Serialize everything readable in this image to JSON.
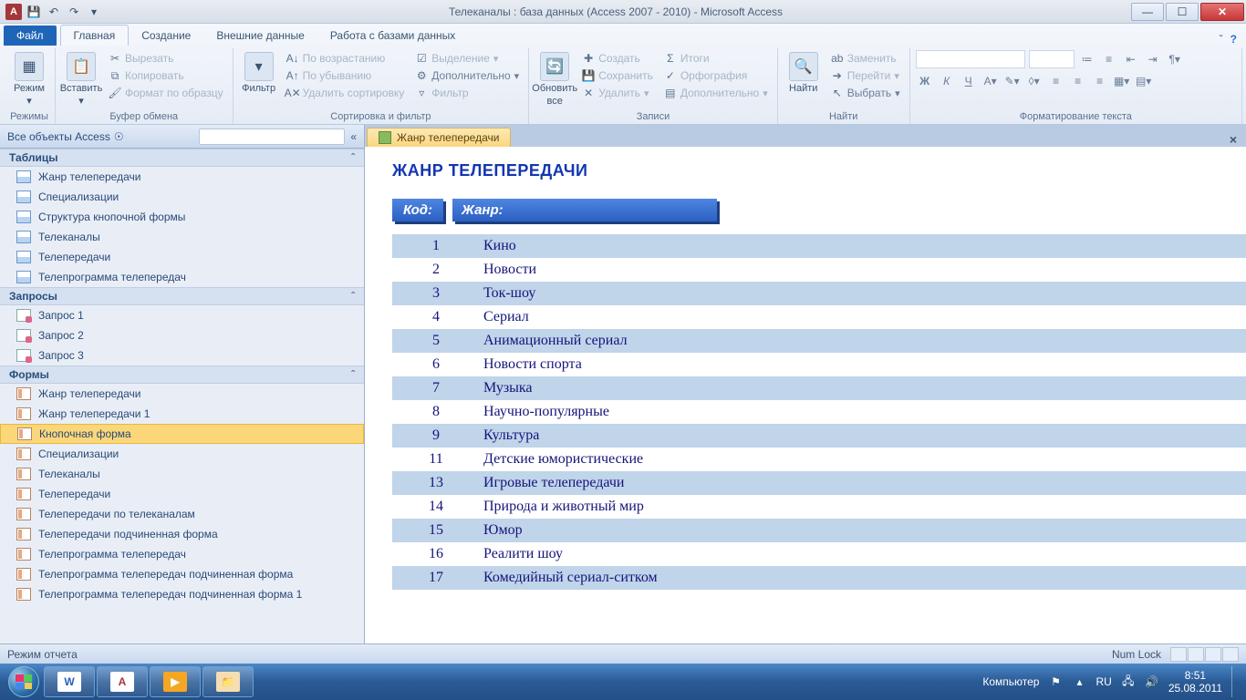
{
  "window": {
    "title": "Телеканалы : база данных (Access 2007 - 2010)  -  Microsoft Access"
  },
  "ribbon": {
    "file": "Файл",
    "tabs": [
      "Главная",
      "Создание",
      "Внешние данные",
      "Работа с базами данных"
    ],
    "groups": {
      "modes": "Режимы",
      "mode": "Режим",
      "clipboard": "Буфер обмена",
      "paste": "Вставить",
      "cut": "Вырезать",
      "copy": "Копировать",
      "fmtpaint": "Формат по образцу",
      "sortfilter": "Сортировка и фильтр",
      "filter": "Фильтр",
      "asc": "По возрастанию",
      "desc": "По убыванию",
      "clrsort": "Удалить сортировку",
      "selection": "Выделение",
      "advanced": "Дополнительно",
      "applyfilter": "Фильтр",
      "records": "Записи",
      "refresh": "Обновить",
      "refresh2": "все",
      "new": "Создать",
      "save": "Сохранить",
      "delete": "Удалить",
      "totals": "Итоги",
      "spell": "Орфография",
      "more": "Дополнительно",
      "findg": "Найти",
      "find": "Найти",
      "replace": "Заменить",
      "goto": "Перейти",
      "select": "Выбрать",
      "textfmt": "Форматирование текста"
    }
  },
  "nav": {
    "title": "Все объекты Access",
    "cat_tables": "Таблицы",
    "tables": [
      "Жанр телепередачи",
      "Специализации",
      "Структура кнопочной формы",
      "Телеканалы",
      "Телепередачи",
      "Телепрограмма телепередач"
    ],
    "cat_queries": "Запросы",
    "queries": [
      "Запрос 1",
      "Запрос 2",
      "Запрос 3"
    ],
    "cat_forms": "Формы",
    "forms": [
      "Жанр телепередачи",
      "Жанр телепередачи 1",
      "Кнопочная форма",
      "Специализации",
      "Телеканалы",
      "Телепередачи",
      "Телепередачи по телеканалам",
      "Телепередачи подчиненная форма",
      "Телепрограмма телепередач",
      "Телепрограмма телепередач подчиненная форма",
      "Телепрограмма телепередач подчиненная форма 1"
    ]
  },
  "doc": {
    "tab": "Жанр телепередачи",
    "title": "ЖАНР ТЕЛЕПЕРЕДАЧИ",
    "col_code": "Код:",
    "col_genre": "Жанр:",
    "rows": [
      {
        "id": "1",
        "name": "Кино"
      },
      {
        "id": "2",
        "name": "Новости"
      },
      {
        "id": "3",
        "name": "Ток-шоу"
      },
      {
        "id": "4",
        "name": "Сериал"
      },
      {
        "id": "5",
        "name": "Анимационный сериал"
      },
      {
        "id": "6",
        "name": "Новости спорта"
      },
      {
        "id": "7",
        "name": "Музыка"
      },
      {
        "id": "8",
        "name": "Научно-популярные"
      },
      {
        "id": "9",
        "name": "Культура"
      },
      {
        "id": "11",
        "name": "Детские юмористические"
      },
      {
        "id": "13",
        "name": "Игровые телепередачи"
      },
      {
        "id": "14",
        "name": "Природа и животный мир"
      },
      {
        "id": "15",
        "name": "Юмор"
      },
      {
        "id": "16",
        "name": "Реалити шоу"
      },
      {
        "id": "17",
        "name": "Комедийный сериал-ситком"
      }
    ]
  },
  "status": {
    "mode": "Режим отчета",
    "numlock": "Num Lock"
  },
  "tray": {
    "computer": "Компьютер",
    "lang": "RU",
    "time": "8:51",
    "date": "25.08.2011"
  }
}
